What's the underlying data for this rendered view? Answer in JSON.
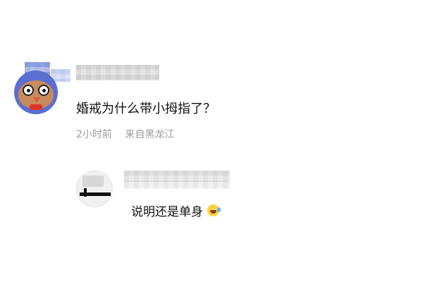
{
  "comment": {
    "text": "婚戒为什么带小拇指了？",
    "time": "2小时前",
    "location": "来自黑龙江"
  },
  "reply": {
    "text": "说明还是单身",
    "emoji_icon": "laughing-with-tears-icon"
  },
  "colors": {
    "main_text": "#111111",
    "meta_text": "#9b9b9b",
    "avatar_main_bg": "#5a6fd0"
  }
}
